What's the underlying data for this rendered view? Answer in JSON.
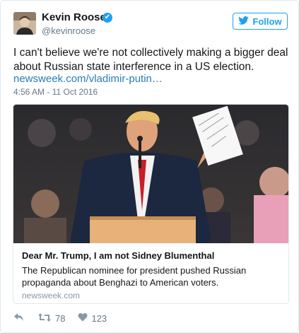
{
  "user": {
    "name": "Kevin Roose",
    "handle": "@kevinroose",
    "verified_glyph": "✔"
  },
  "follow_button": {
    "label": "Follow"
  },
  "tweet": {
    "text": "I can't believe we're not collectively making a bigger deal about Russian state interference in a US election.",
    "link": "newsweek.com/vladimir-putin…",
    "timestamp": "4:56 AM - 11 Oct 2016"
  },
  "card": {
    "title": "Dear Mr. Trump, I am not Sidney Blumenthal",
    "description": "The Republican nominee for president pushed Russian propaganda about Benghazi to American voters.",
    "domain": "newsweek.com"
  },
  "actions": {
    "retweets": "78",
    "likes": "123"
  },
  "colors": {
    "accent": "#1da1f2",
    "link": "#2b7bb9",
    "muted": "#657786",
    "border": "#e1e8ed"
  },
  "icons": [
    "twitter-bird-icon",
    "verified-badge-icon",
    "reply-icon",
    "retweet-icon",
    "heart-icon"
  ]
}
